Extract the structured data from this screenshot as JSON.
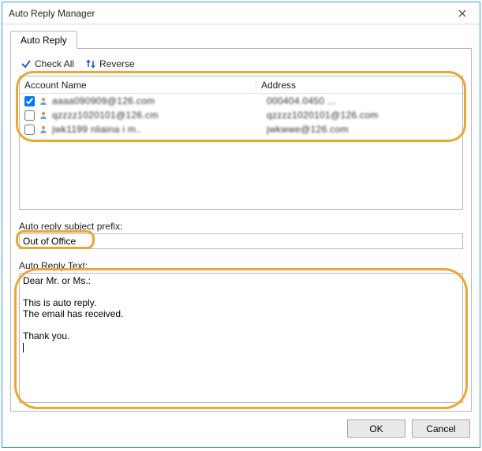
{
  "window": {
    "title": "Auto Reply Manager"
  },
  "tabs": {
    "auto_reply": "Auto Reply"
  },
  "toolbar": {
    "check_all": "Check All",
    "reverse": "Reverse"
  },
  "accounts": {
    "headers": {
      "account": "Account Name",
      "address": "Address"
    },
    "rows": [
      {
        "checked": true,
        "account": "aaaa090909@126.com",
        "address": "000404.0450 ..."
      },
      {
        "checked": false,
        "account": "qzzzz1020101@126.cm",
        "address": "qzzzz1020101@126.com"
      },
      {
        "checked": false,
        "account": "jwk1199 nliaina i m..",
        "address": "jwkwwe@126.com"
      }
    ]
  },
  "prefix": {
    "label": "Auto reply subject prefix:",
    "value": "Out of Office"
  },
  "body": {
    "label": "Auto Reply Text:",
    "value": "Dear Mr. or Ms.:\n\nThis is auto reply.\nThe email has received.\n\nThank you.\n"
  },
  "buttons": {
    "ok": "OK",
    "cancel": "Cancel"
  },
  "icons": {
    "check": "check-icon",
    "reverse": "reverse-icon",
    "person": "person-icon",
    "close": "close-icon"
  },
  "colors": {
    "border": "#3a9ecb",
    "annotation": "#e6a836",
    "check_blue": "#2b5fb4"
  }
}
